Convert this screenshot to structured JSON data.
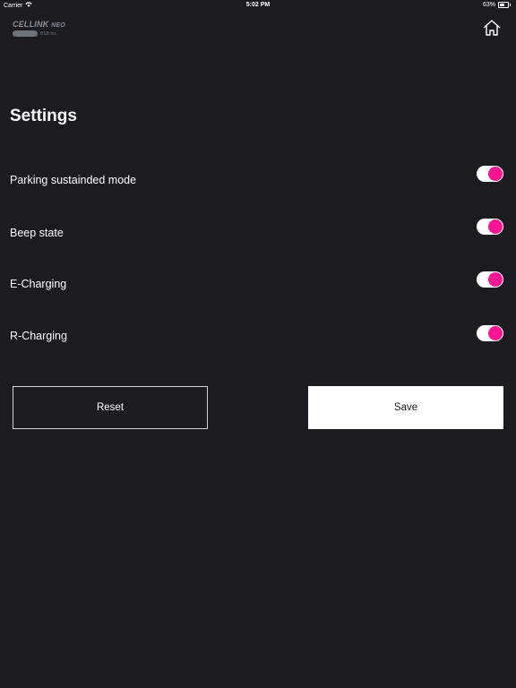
{
  "status_bar": {
    "carrier": "Carrier",
    "time": "5:02 PM",
    "battery_percent": "63%",
    "battery_level": 0.63,
    "wifi_icon": "wifi-icon",
    "battery_icon": "battery-icon"
  },
  "logo": {
    "brand": "CELLINK",
    "brand_suffix": "NEO",
    "company": "BSB Inc."
  },
  "header": {
    "home_icon": "home-icon"
  },
  "page": {
    "title": "Settings"
  },
  "settings": [
    {
      "label": "Parking sustainded mode",
      "enabled": true
    },
    {
      "label": "Beep state",
      "enabled": true
    },
    {
      "label": "E-Charging",
      "enabled": true
    },
    {
      "label": "R-Charging",
      "enabled": true
    }
  ],
  "actions": {
    "reset_label": "Reset",
    "save_label": "Save"
  },
  "colors": {
    "background": "#1c1c20",
    "toggle_track": "#ffffff",
    "toggle_knob": "#ff1493"
  }
}
